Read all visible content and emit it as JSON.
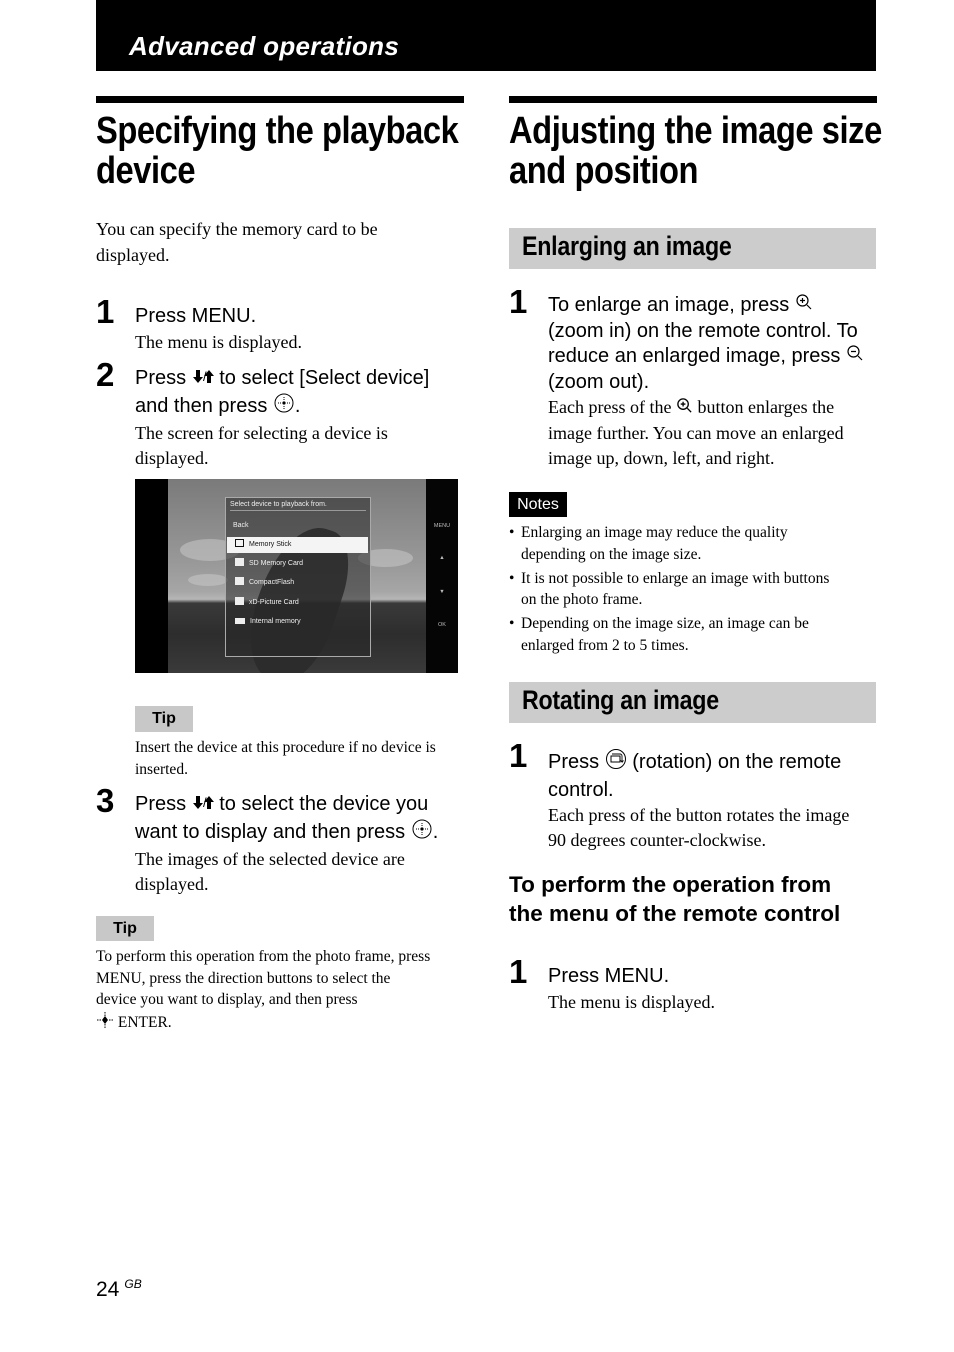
{
  "header": {
    "section_title": "Advanced operations"
  },
  "left": {
    "title_lines": [
      "Specifying the playback",
      "device"
    ],
    "intro": [
      "You can specify the memory card to be",
      "displayed."
    ],
    "steps": [
      {
        "num": "1",
        "instruction_lines": [
          "Press MENU."
        ],
        "result_lines": [
          "The menu is displayed."
        ]
      },
      {
        "num": "2",
        "instruction_parts": [
          "Press ",
          " to select [Select device]",
          "and then press ",
          "."
        ],
        "result_lines": [
          "The screen for selecting a device is",
          "displayed."
        ]
      },
      {
        "num": "3",
        "instruction_parts": [
          "Press ",
          " to select the device you",
          "want to display and then press ",
          "."
        ],
        "result_lines": [
          "The images of the selected device are",
          "displayed."
        ]
      }
    ],
    "screen": {
      "menu_title": "Select device to playback from.",
      "back": "Back",
      "items": [
        {
          "label": "Memory Stick",
          "icon": "memory-stick-icon",
          "selected": true
        },
        {
          "label": "SD Memory Card",
          "icon": "sd-card-icon",
          "selected": false
        },
        {
          "label": "CompactFlash",
          "icon": "compactflash-icon",
          "selected": false
        },
        {
          "label": "xD-Picture Card",
          "icon": "xd-card-icon",
          "selected": false
        },
        {
          "label": "Internal memory",
          "icon": "internal-memory-icon",
          "selected": false
        }
      ],
      "side_labels": [
        "MENU",
        "▲",
        "▼",
        "OK"
      ]
    },
    "tip1": {
      "label": "Tip",
      "lines": [
        "Insert the device at this procedure if no device is",
        "inserted."
      ]
    },
    "tip2": {
      "label": "Tip",
      "lines": [
        "To perform this operation from the photo frame, press",
        "MENU, press the direction buttons to select the",
        "device you want to display, and then press"
      ],
      "last_line_suffix": " ENTER."
    }
  },
  "right": {
    "title_lines": [
      "Adjusting the image size",
      "and position"
    ],
    "enlarge": {
      "heading": "Enlarging an image",
      "step": {
        "num": "1",
        "instruction_parts": [
          "To enlarge an image, press ",
          "(zoom in) on the remote control. To",
          "reduce an enlarged image, press ",
          "(zoom out)."
        ],
        "result_parts": [
          "Each press of the ",
          " button enlarges the",
          "image further. You can move an enlarged",
          "image up, down, left, and right."
        ]
      }
    },
    "notes": {
      "label": "Notes",
      "items": [
        [
          "Enlarging an image may reduce the quality",
          "depending on the image size."
        ],
        [
          "It is not possible to enlarge an image with buttons",
          "on the photo frame."
        ],
        [
          "Depending on the image size, an image can be",
          "enlarged from 2 to 5 times."
        ]
      ]
    },
    "rotate": {
      "heading": "Rotating an image",
      "step": {
        "num": "1",
        "instruction_parts": [
          "Press ",
          " (rotation) on the remote",
          "control."
        ],
        "result_lines": [
          "Each press of the button rotates the image",
          "90 degrees counter-clockwise."
        ]
      }
    },
    "menu_op": {
      "heading_lines": [
        "To perform the operation from",
        "the menu of the remote control"
      ],
      "step": {
        "num": "1",
        "instruction_lines": [
          "Press MENU."
        ],
        "result_lines": [
          "The menu is displayed."
        ]
      }
    }
  },
  "footer": {
    "page_number": "24",
    "region": "GB"
  }
}
